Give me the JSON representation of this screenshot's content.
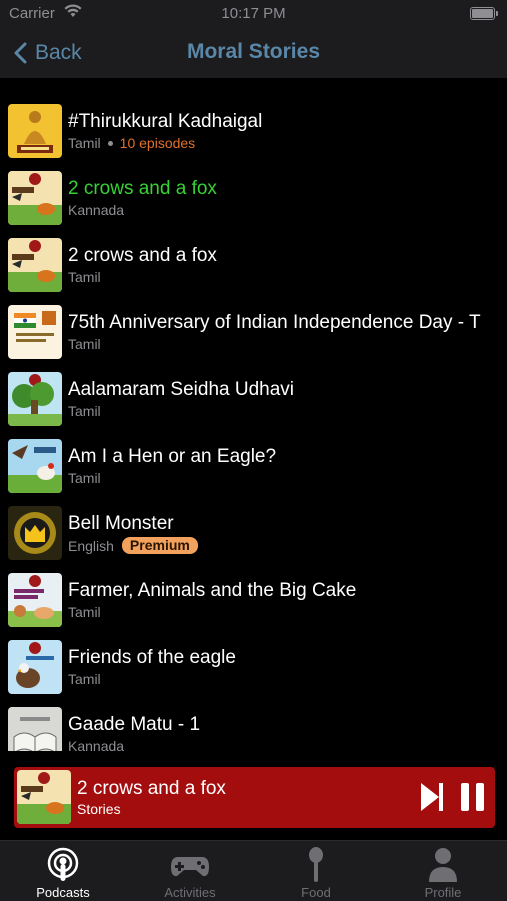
{
  "status_bar": {
    "carrier": "Carrier",
    "time": "10:17 PM"
  },
  "nav": {
    "back_label": "Back",
    "title": "Moral Stories"
  },
  "colors": {
    "accent": "#5a87a8",
    "active_title": "#36d236",
    "episodes": "#e0702a",
    "premium": "#f2a25c",
    "player_bg": "#a40d0d"
  },
  "stories": [
    {
      "title": "#Thirukkural Kadhaigal",
      "language": "Tamil",
      "episodes": "10 episodes",
      "art": "thirukkural-art",
      "active": false
    },
    {
      "title": "2 crows and a fox",
      "language": "Kannada",
      "art": "crows-fox-art",
      "active": true
    },
    {
      "title": "2 crows and a fox",
      "language": "Tamil",
      "art": "crows-fox-art",
      "active": false
    },
    {
      "title": "75th Anniversary of Indian Independence Day - T",
      "language": "Tamil",
      "art": "independence-art",
      "active": false
    },
    {
      "title": "Aalamaram Seidha Udhavi",
      "language": "Tamil",
      "art": "tree-art",
      "active": false
    },
    {
      "title": "Am I a Hen or an Eagle?",
      "language": "Tamil",
      "art": "hen-eagle-art",
      "active": false
    },
    {
      "title": "Bell Monster",
      "language": "English",
      "badge": "Premium",
      "art": "crown-art",
      "active": false
    },
    {
      "title": "Farmer, Animals and the Big Cake",
      "language": "Tamil",
      "art": "farmer-art",
      "active": false
    },
    {
      "title": "Friends of the eagle",
      "language": "Tamil",
      "art": "eagle-art",
      "active": false
    },
    {
      "title": "Gaade Matu - 1",
      "language": "Kannada",
      "art": "book-art",
      "active": false
    }
  ],
  "player": {
    "title": "2 crows and a fox",
    "subtitle": "Stories",
    "art": "crows-fox-art"
  },
  "tabs": [
    {
      "label": "Podcasts",
      "icon": "podcast-icon",
      "selected": true
    },
    {
      "label": "Activities",
      "icon": "gamepad-icon",
      "selected": false
    },
    {
      "label": "Food",
      "icon": "spoon-icon",
      "selected": false
    },
    {
      "label": "Profile",
      "icon": "person-icon",
      "selected": false
    }
  ]
}
